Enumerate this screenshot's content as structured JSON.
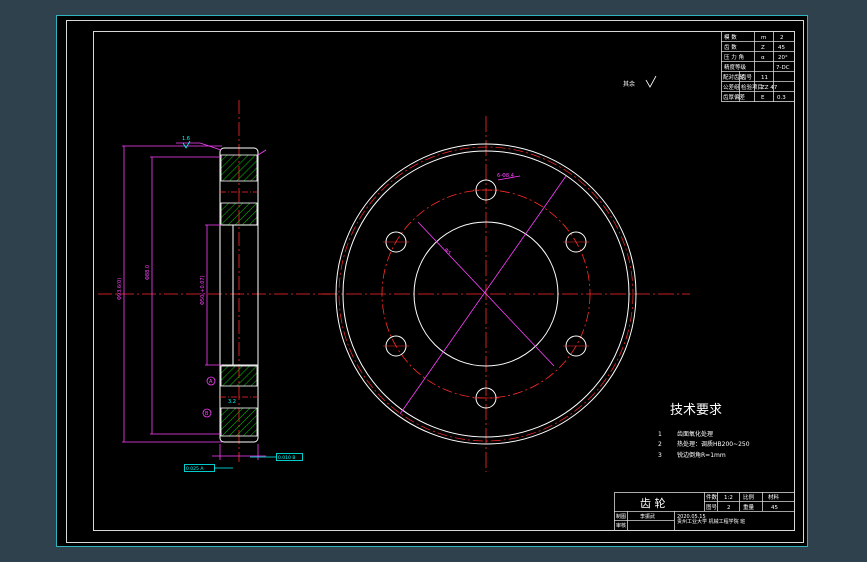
{
  "colors": {
    "background": "#2e414d",
    "canvas": "#000000",
    "frame": "#d8d8d8",
    "border_cyan": "#2fb3bf",
    "red": "#ff2a2a",
    "magenta": "#ff40ff",
    "green": "#00c800",
    "cyan": "#00ffff",
    "text": "#ffffff"
  },
  "param_table": {
    "rows": [
      {
        "label": "模  数",
        "value": "m",
        "value2": "2"
      },
      {
        "label": "齿  数",
        "value": "Z",
        "value2": "45"
      },
      {
        "label": "压 力 角",
        "value": "α",
        "value2": "20°"
      },
      {
        "label": "精度等级",
        "value": "",
        "value2": "7-DC"
      },
      {
        "label": "配对齿轮",
        "value": "齿号",
        "value2": "11"
      },
      {
        "label": "公差组",
        "value": "检验项目",
        "value2": "ZZ 47"
      },
      {
        "label": "齿厚偏差",
        "value": "E",
        "value2": "0.3"
      }
    ]
  },
  "other_roughness": "其余",
  "side_view": {
    "roughness_top": "1.6",
    "roughness_side": "3.2",
    "dim_outer": "Φ93.6(0)",
    "dim_mid": "Φ88.0",
    "dim_bore": "Φ50(+0.07)",
    "datum_a": "A",
    "datum_b": "B",
    "tol_left": "0.025 A",
    "tol_right": "0.010 B"
  },
  "front_view": {
    "hole_note": "6-Φ8.4",
    "bolt_circle_dim": "Φ5"
  },
  "tech_requirements": {
    "title": "技术要求",
    "items": [
      {
        "num": "1",
        "text": "齿面氧化处理"
      },
      {
        "num": "2",
        "text": "热处理：调质HB200~250"
      },
      {
        "num": "3",
        "text": "锐边倒角R=1mm"
      }
    ]
  },
  "title_block": {
    "part_name": "齿 轮",
    "scale_label": "比例",
    "scale_value": "1:2",
    "material_label": "材料",
    "material_value": "45",
    "drawing_no_label": "件数",
    "drawing_no_value": "2",
    "weight_label": "重量",
    "weight_value": "",
    "sheet_label": "图号",
    "sheet_value": "",
    "designer_label": "制图",
    "designer_name": "李振武",
    "date": "2020.05.15",
    "checker_label": "审核",
    "company": "贵州工业大学 机械工程学院 班"
  }
}
